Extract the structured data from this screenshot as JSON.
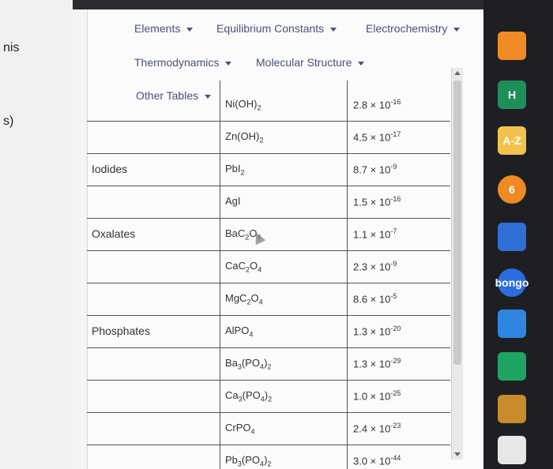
{
  "left_window": {
    "fragment_top": "nis",
    "fragment_mid": "s)"
  },
  "menu": {
    "elements": "Elements",
    "equilibrium": "Equilibrium Constants",
    "electrochemistry": "Electrochemistry",
    "thermodynamics": "Thermodynamics",
    "molecular_structure": "Molecular Structure",
    "other_tables": "Other Tables"
  },
  "table": {
    "rows": [
      {
        "category": "",
        "formula_html": "Ni(OH)<sub>2</sub>",
        "ksp_html": "2.8 × 10<sup>-16</sup>"
      },
      {
        "category": "",
        "formula_html": "Zn(OH)<sub>2</sub>",
        "ksp_html": "4.5 × 10<sup>-17</sup>"
      },
      {
        "category": "Iodides",
        "formula_html": "PbI<sub>2</sub>",
        "ksp_html": "8.7 × 10<sup>-9</sup>"
      },
      {
        "category": "",
        "formula_html": "AgI",
        "ksp_html": "1.5 × 10<sup>-16</sup>"
      },
      {
        "category": "Oxalates",
        "formula_html": "BaC<sub>2</sub>O<sub>4</sub>",
        "ksp_html": "1.1 × 10<sup>-7</sup>"
      },
      {
        "category": "",
        "formula_html": "CaC<sub>2</sub>O<sub>4</sub>",
        "ksp_html": "2.3 × 10<sup>-9</sup>"
      },
      {
        "category": "",
        "formula_html": "MgC<sub>2</sub>O<sub>4</sub>",
        "ksp_html": "8.6 × 10<sup>-5</sup>"
      },
      {
        "category": "Phosphates",
        "formula_html": "AlPO<sub>4</sub>",
        "ksp_html": "1.3 × 10<sup>-20</sup>"
      },
      {
        "category": "",
        "formula_html": "Ba<sub>3</sub>(PO<sub>4</sub>)<sub>2</sub>",
        "ksp_html": "1.3 × 10<sup>-29</sup>"
      },
      {
        "category": "",
        "formula_html": "Ca<sub>3</sub>(PO<sub>4</sub>)<sub>2</sub>",
        "ksp_html": "1.0 × 10<sup>-25</sup>"
      },
      {
        "category": "",
        "formula_html": "CrPO<sub>4</sub>",
        "ksp_html": "2.4 × 10<sup>-23</sup>"
      },
      {
        "category": "",
        "formula_html": "Pb<sub>3</sub>(PO<sub>4</sub>)<sub>2</sub>",
        "ksp_html": "3.0 × 10<sup>-44</sup>"
      }
    ]
  },
  "dock": {
    "icons": [
      {
        "name": "rss-icon",
        "label": "",
        "color": "#f08a24"
      },
      {
        "name": "h-icon",
        "label": "H",
        "color": "#1f8f5a"
      },
      {
        "name": "az-icon",
        "label": "A-Z",
        "color": "#f2c14e"
      },
      {
        "name": "p-icon",
        "label": "6",
        "color": "#f08a24"
      },
      {
        "name": "book-icon",
        "label": "",
        "color": "#2f6fd6"
      },
      {
        "name": "bongo-icon",
        "label": "bongo",
        "color": "#2b6de0"
      },
      {
        "name": "cloud-icon",
        "label": "",
        "color": "#2f86e0"
      },
      {
        "name": "drive-icon",
        "label": "",
        "color": "#1fa463"
      },
      {
        "name": "class-icon",
        "label": "",
        "color": "#c98b2b"
      },
      {
        "name": "notes-icon",
        "label": "",
        "color": "#e7e7e7"
      }
    ]
  }
}
